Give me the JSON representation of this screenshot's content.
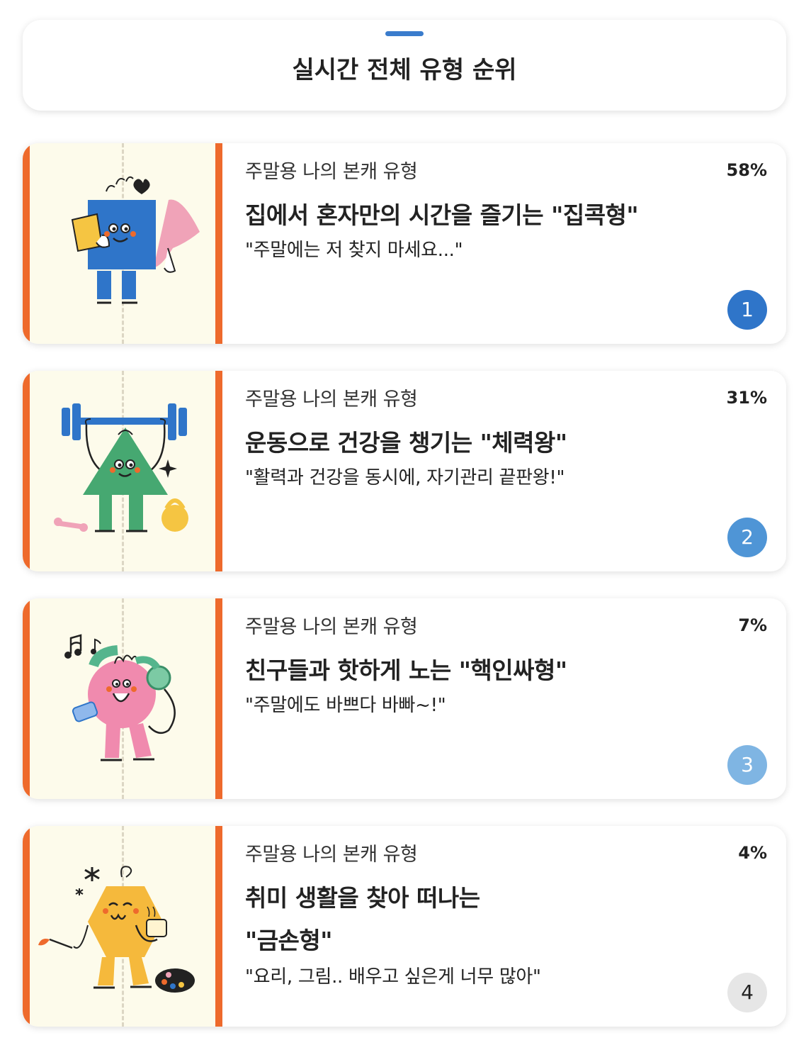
{
  "header": {
    "title": "실시간 전체 유형 순위"
  },
  "colors": {
    "accent_orange": "#ee6a2c",
    "rank1": "#2f75c9",
    "rank2": "#4f95d6",
    "rank3": "#7fb5e3",
    "rank4": "#e6e6e6"
  },
  "ranks": [
    {
      "subtitle": "주말용 나의 본캐 유형",
      "percent": "58%",
      "title": "집에서 혼자만의 시간을 즐기는 \"집콕형\"",
      "quote": "\"주말에는 저 찾지 마세요...\"",
      "rank": "1",
      "illustration": "blue-square-character-with-pillow"
    },
    {
      "subtitle": "주말용 나의 본캐 유형",
      "percent": "31%",
      "title": "운동으로 건강을 챙기는 \"체력왕\"",
      "quote": "\"활력과 건강을 동시에, 자기관리 끝판왕!\"",
      "rank": "2",
      "illustration": "green-triangle-character-lifting-barbell"
    },
    {
      "subtitle": "주말용 나의 본캐 유형",
      "percent": "7%",
      "title": "친구들과 핫하게 노는 \"핵인싸형\"",
      "quote": "\"주말에도 바쁘다 바빠~!\"",
      "rank": "3",
      "illustration": "pink-circle-character-with-headphones"
    },
    {
      "subtitle": "주말용 나의 본캐 유형",
      "percent": "4%",
      "title": "취미 생활을 찾아 떠나는 \"금손형\"",
      "quote": "\"요리, 그림.. 배우고 싶은게 너무 많아\"",
      "rank": "4",
      "illustration": "yellow-hexagon-character-with-palette"
    }
  ]
}
